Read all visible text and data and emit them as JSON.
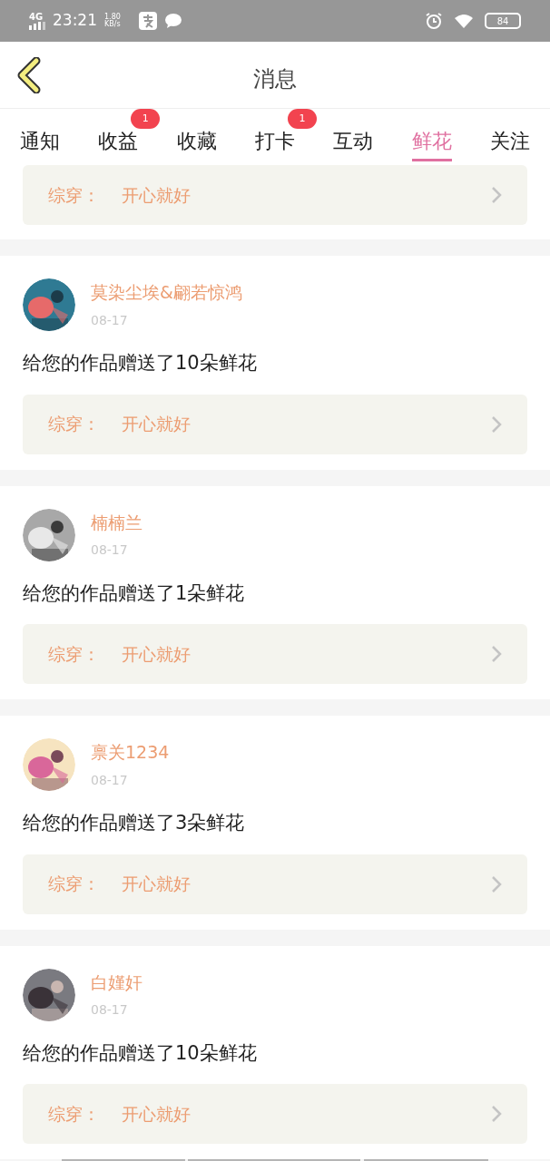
{
  "status_bar": {
    "network": "4G",
    "time": "23:21",
    "speed": "1.80",
    "speed_unit": "KB/s",
    "battery": "84"
  },
  "header": {
    "title": "消息"
  },
  "tabs": [
    {
      "label": "通知",
      "selected": false
    },
    {
      "label": "收益",
      "selected": false,
      "badge": "1"
    },
    {
      "label": "收藏",
      "selected": false
    },
    {
      "label": "打卡",
      "selected": false,
      "badge": "1"
    },
    {
      "label": "互动",
      "selected": false
    },
    {
      "label": "鲜花",
      "selected": true
    },
    {
      "label": "关注",
      "selected": false
    }
  ],
  "top_work": {
    "label": "综穿：",
    "title": "开心就好"
  },
  "messages": [
    {
      "name": "莫染尘埃&翩若惊鸿",
      "date": "08-17",
      "text": "给您的作品赠送了10朵鲜花",
      "work_label": "综穿：",
      "work_title": "开心就好"
    },
    {
      "name": "楠楠兰",
      "date": "08-17",
      "text": "给您的作品赠送了1朵鲜花",
      "work_label": "综穿：",
      "work_title": "开心就好"
    },
    {
      "name": "禀关1234",
      "date": "08-17",
      "text": "给您的作品赠送了3朵鲜花",
      "work_label": "综穿：",
      "work_title": "开心就好"
    },
    {
      "name": "白嫤奸",
      "date": "08-17",
      "text": "给您的作品赠送了10朵鲜花",
      "work_label": "综穿：",
      "work_title": "开心就好"
    }
  ]
}
